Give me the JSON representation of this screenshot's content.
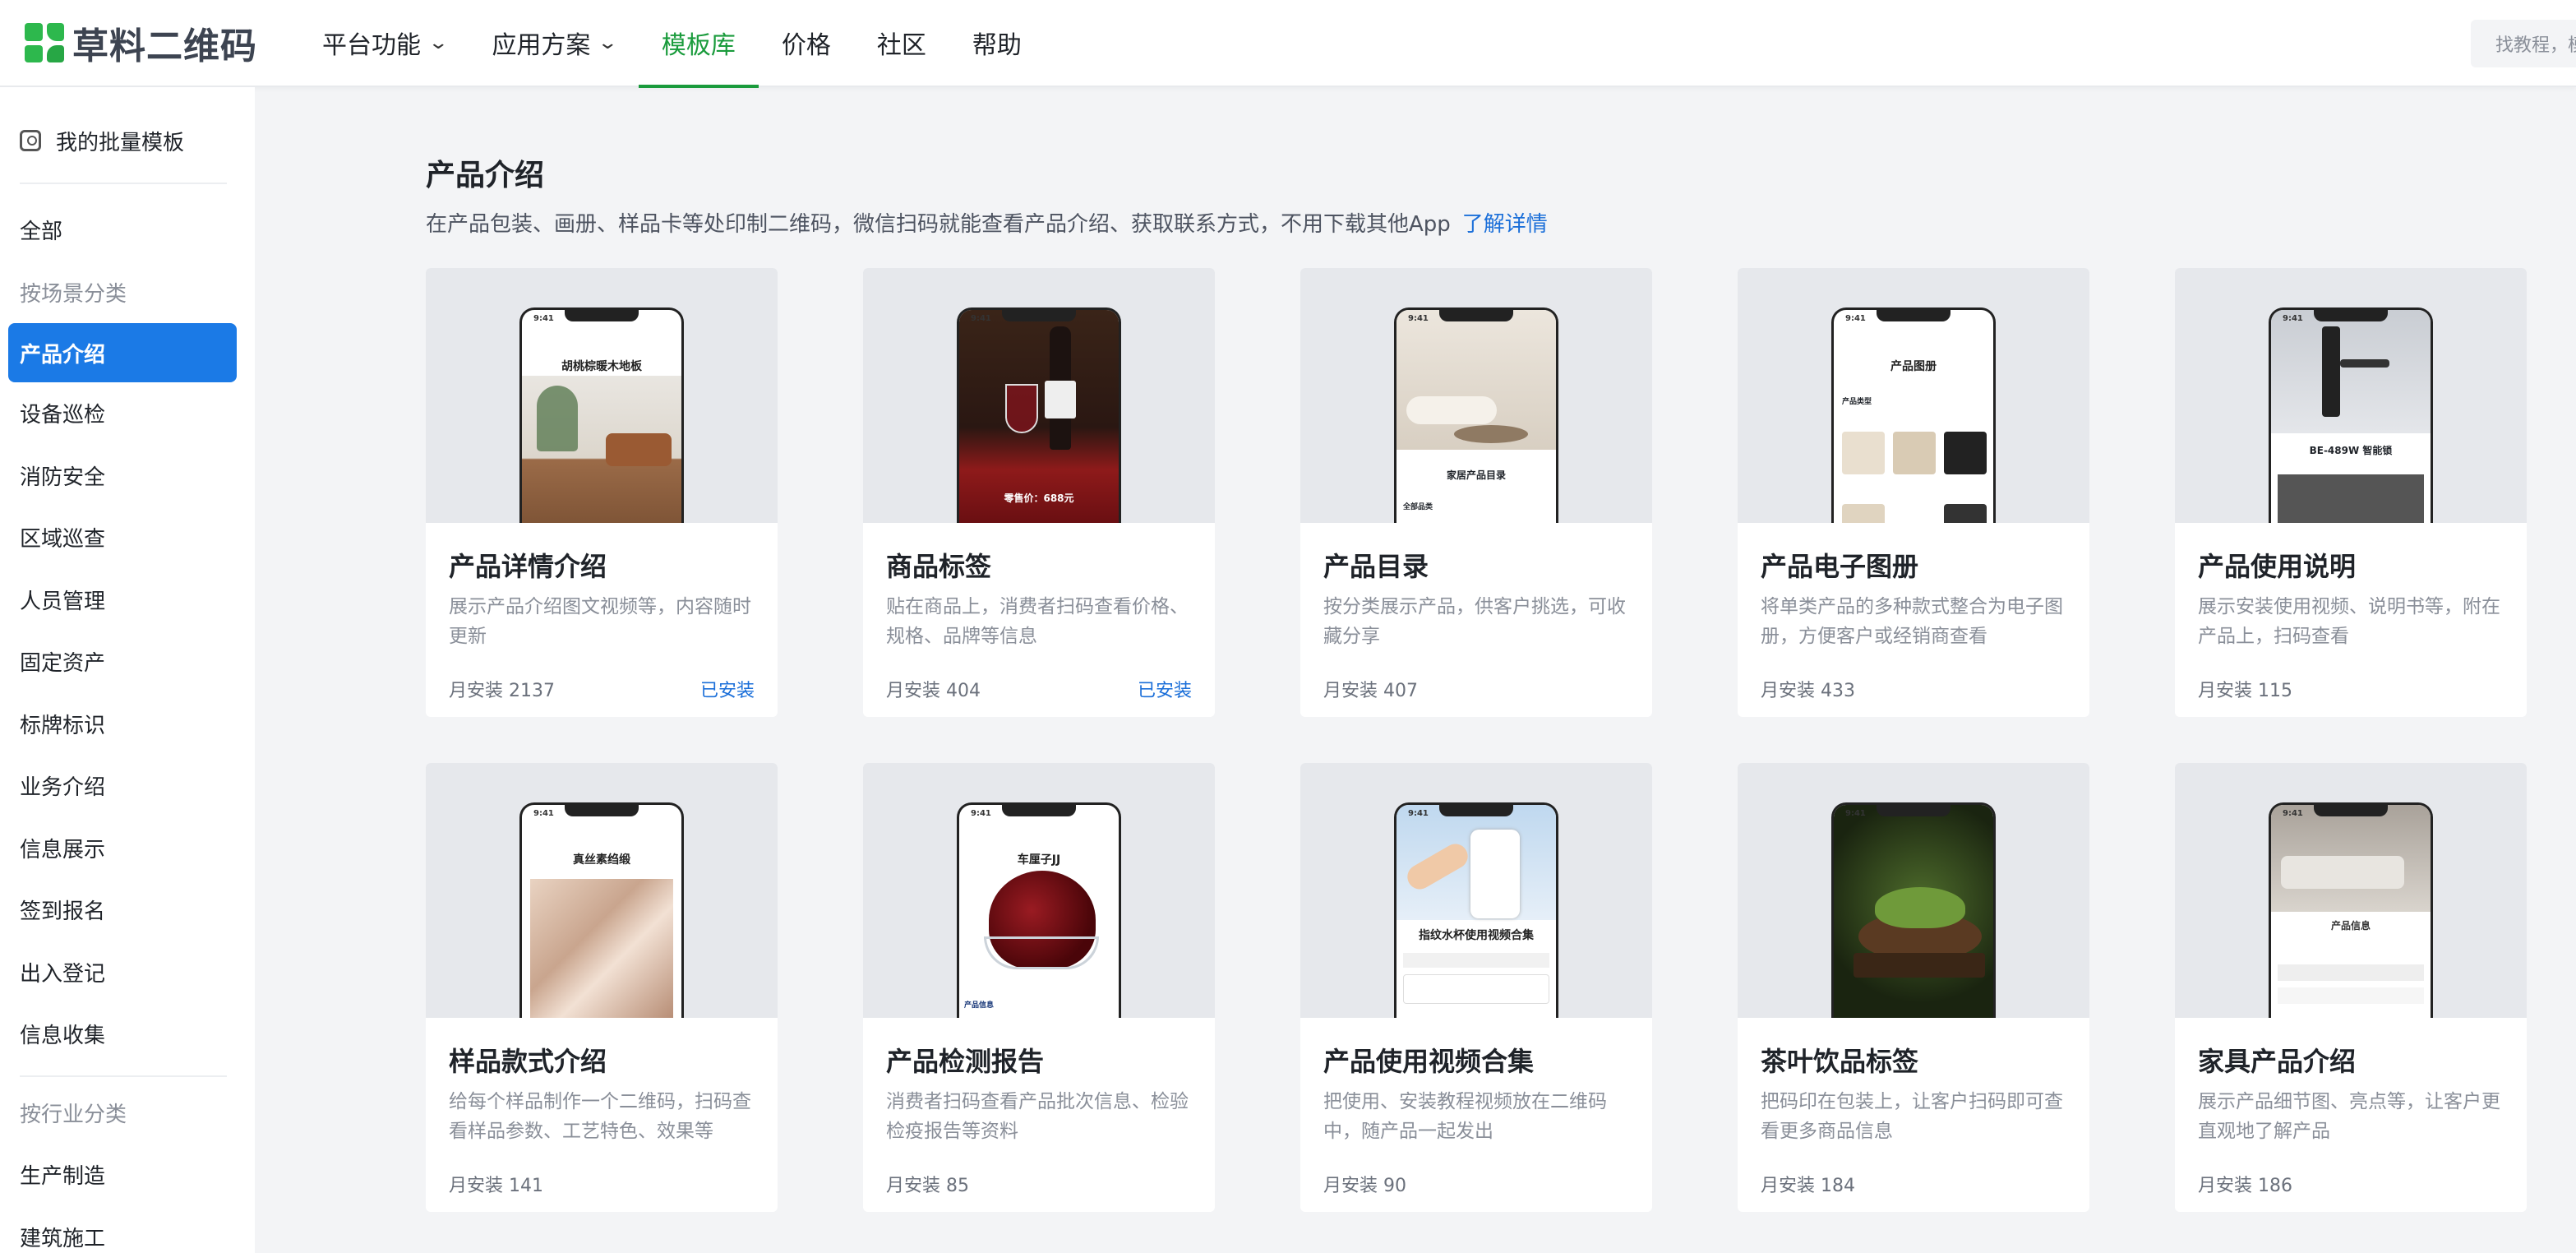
{
  "brand": {
    "name": "草料二维码"
  },
  "nav": [
    {
      "label": "平台功能",
      "dropdown": true,
      "active": false
    },
    {
      "label": "应用方案",
      "dropdown": true,
      "active": false
    },
    {
      "label": "模板库",
      "dropdown": false,
      "active": true
    },
    {
      "label": "价格",
      "dropdown": false,
      "active": false
    },
    {
      "label": "社区",
      "dropdown": false,
      "active": false
    },
    {
      "label": "帮助",
      "dropdown": false,
      "active": false
    }
  ],
  "search": {
    "placeholder": "找教程，模板…"
  },
  "sidebar": {
    "my_templates": "我的批量模板",
    "items": [
      {
        "label": "全部",
        "type": "item"
      },
      {
        "label": "按场景分类",
        "type": "group"
      },
      {
        "label": "产品介绍",
        "type": "item",
        "active": true
      },
      {
        "label": "设备巡检",
        "type": "item"
      },
      {
        "label": "消防安全",
        "type": "item"
      },
      {
        "label": "区域巡查",
        "type": "item"
      },
      {
        "label": "人员管理",
        "type": "item"
      },
      {
        "label": "固定资产",
        "type": "item"
      },
      {
        "label": "标牌标识",
        "type": "item"
      },
      {
        "label": "业务介绍",
        "type": "item"
      },
      {
        "label": "信息展示",
        "type": "item"
      },
      {
        "label": "签到报名",
        "type": "item"
      },
      {
        "label": "出入登记",
        "type": "item"
      },
      {
        "label": "信息收集",
        "type": "item"
      }
    ],
    "items2": [
      {
        "label": "按行业分类",
        "type": "group"
      },
      {
        "label": "生产制造",
        "type": "item"
      },
      {
        "label": "建筑施工",
        "type": "item"
      }
    ]
  },
  "section": {
    "title": "产品介绍",
    "desc": "在产品包装、画册、样品卡等处印制二维码，微信扫码就能查看产品介绍、获取联系方式，不用下载其他App",
    "link": "了解详情"
  },
  "colors": {
    "accent_green": "#1a9b3c",
    "active_blue": "#1b7ae6",
    "link_blue": "#1b6fd9"
  },
  "cards": [
    {
      "title": "产品详情介绍",
      "desc": "展示产品介绍图文视频等，内容随时更新",
      "stat": "月安装 2137",
      "installed": "已安装",
      "phone_title": "胡桃棕暖木地板",
      "theme": "floor"
    },
    {
      "title": "商品标签",
      "desc": "贴在商品上，消费者扫码查看价格、规格、品牌等信息",
      "stat": "月安装 404",
      "installed": "已安装",
      "phone_title": "零售价：688元",
      "theme": "wine"
    },
    {
      "title": "产品目录",
      "desc": "按分类展示产品，供客户挑选，可收藏分享",
      "stat": "月安装 407",
      "installed": "",
      "phone_title": "家居产品目录",
      "theme": "sofa"
    },
    {
      "title": "产品电子图册",
      "desc": "将单类产品的多种款式整合为电子图册，方便客户或经销商查看",
      "stat": "月安装 433",
      "installed": "",
      "phone_title": "产品图册",
      "theme": "album"
    },
    {
      "title": "产品使用说明",
      "desc": "展示安装使用视频、说明书等，附在产品上，扫码查看",
      "stat": "月安装 115",
      "installed": "",
      "phone_title": "BE-489W 智能锁",
      "theme": "lock"
    },
    {
      "title": "样品款式介绍",
      "desc": "给每个样品制作一个二维码，扫码查看样品参数、工艺特色、效果等",
      "stat": "月安装 141",
      "installed": "",
      "phone_title": "真丝素绉缎",
      "theme": "silk"
    },
    {
      "title": "产品检测报告",
      "desc": "消费者扫码查看产品批次信息、检验检疫报告等资料",
      "stat": "月安装 85",
      "installed": "",
      "phone_title": "车厘子JJ",
      "theme": "cherry"
    },
    {
      "title": "产品使用视频合集",
      "desc": "把使用、安装教程视频放在二维码中，随产品一起发出",
      "stat": "月安装 90",
      "installed": "",
      "phone_title": "指纹水杯使用视频合集",
      "theme": "cup"
    },
    {
      "title": "茶叶饮品标签",
      "desc": "把码印在包装上，让客户扫码即可查看更多商品信息",
      "stat": "月安装 184",
      "installed": "",
      "phone_title": "",
      "theme": "tea"
    },
    {
      "title": "家具产品介绍",
      "desc": "展示产品细节图、亮点等，让客户更直观地了解产品",
      "stat": "月安装 186",
      "installed": "",
      "phone_title": "产品信息",
      "theme": "furniture"
    }
  ]
}
